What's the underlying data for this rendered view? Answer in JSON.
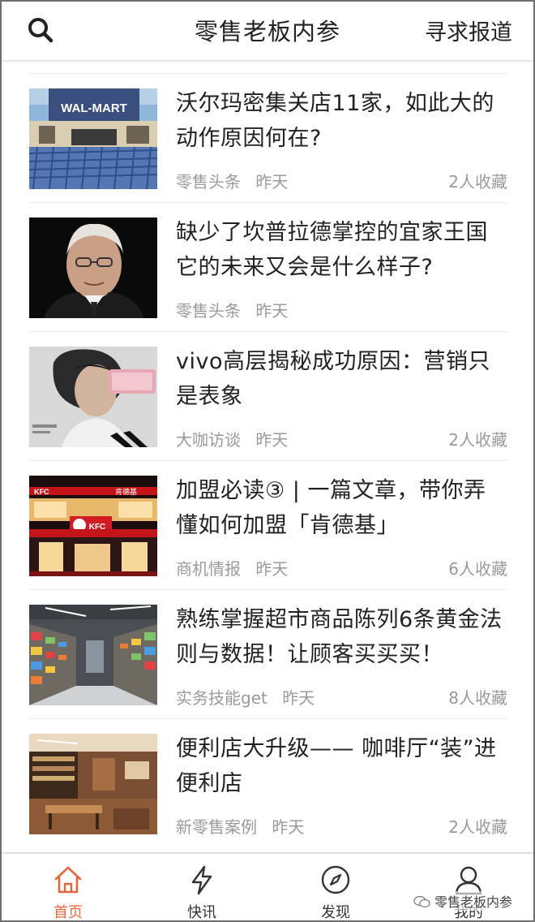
{
  "header": {
    "title": "零售老板内参",
    "action_label": "寻求报道",
    "search_icon": "search-icon"
  },
  "articles": [
    {
      "title": "沃尔玛密集关店11家，如此大的动作原因何在?",
      "source": "零售头条",
      "time": "昨天",
      "saves": "2人收藏",
      "thumb": "walmart-store-photo"
    },
    {
      "title": "缺少了坎普拉德掌控的宜家王国它的未来又会是什么样子?",
      "source": "零售头条",
      "time": "昨天",
      "saves": "",
      "thumb": "elderly-man-portrait-photo"
    },
    {
      "title": "vivo高层揭秘成功原因：营销只是表象",
      "source": "大咖访谈",
      "time": "昨天",
      "saves": "2人收藏",
      "thumb": "woman-with-phone-ad-photo"
    },
    {
      "title": "加盟必读③ | 一篇文章，带你弄懂如何加盟「肯德基」",
      "source": "商机情报",
      "time": "昨天",
      "saves": "6人收藏",
      "thumb": "kfc-storefront-photo"
    },
    {
      "title": "熟练掌握超市商品陈列6条黄金法则与数据！让顾客买买买！",
      "source": "实务技能get",
      "time": "昨天",
      "saves": "8人收藏",
      "thumb": "supermarket-aisle-photo"
    },
    {
      "title": "便利店大升级—— 咖啡厅“装”进便利店",
      "source": "新零售案例",
      "time": "昨天",
      "saves": "2人收藏",
      "thumb": "convenience-store-interior-photo"
    }
  ],
  "thumb_text": {
    "walmart_sign": "WAL-MART",
    "kfc_sign": "KFC",
    "kfc_cn_sign": "肯德基"
  },
  "bottom_nav": [
    {
      "label": "首页",
      "icon": "home-icon",
      "active": true
    },
    {
      "label": "快讯",
      "icon": "lightning-icon",
      "active": false
    },
    {
      "label": "发现",
      "icon": "compass-icon",
      "active": false
    },
    {
      "label": "我的",
      "icon": "user-icon",
      "active": false
    }
  ],
  "watermark": "零售老板内参",
  "colors": {
    "accent": "#e5663a",
    "text_primary": "#222222",
    "text_meta": "#9a9a9a",
    "divider": "#eaeaea"
  }
}
